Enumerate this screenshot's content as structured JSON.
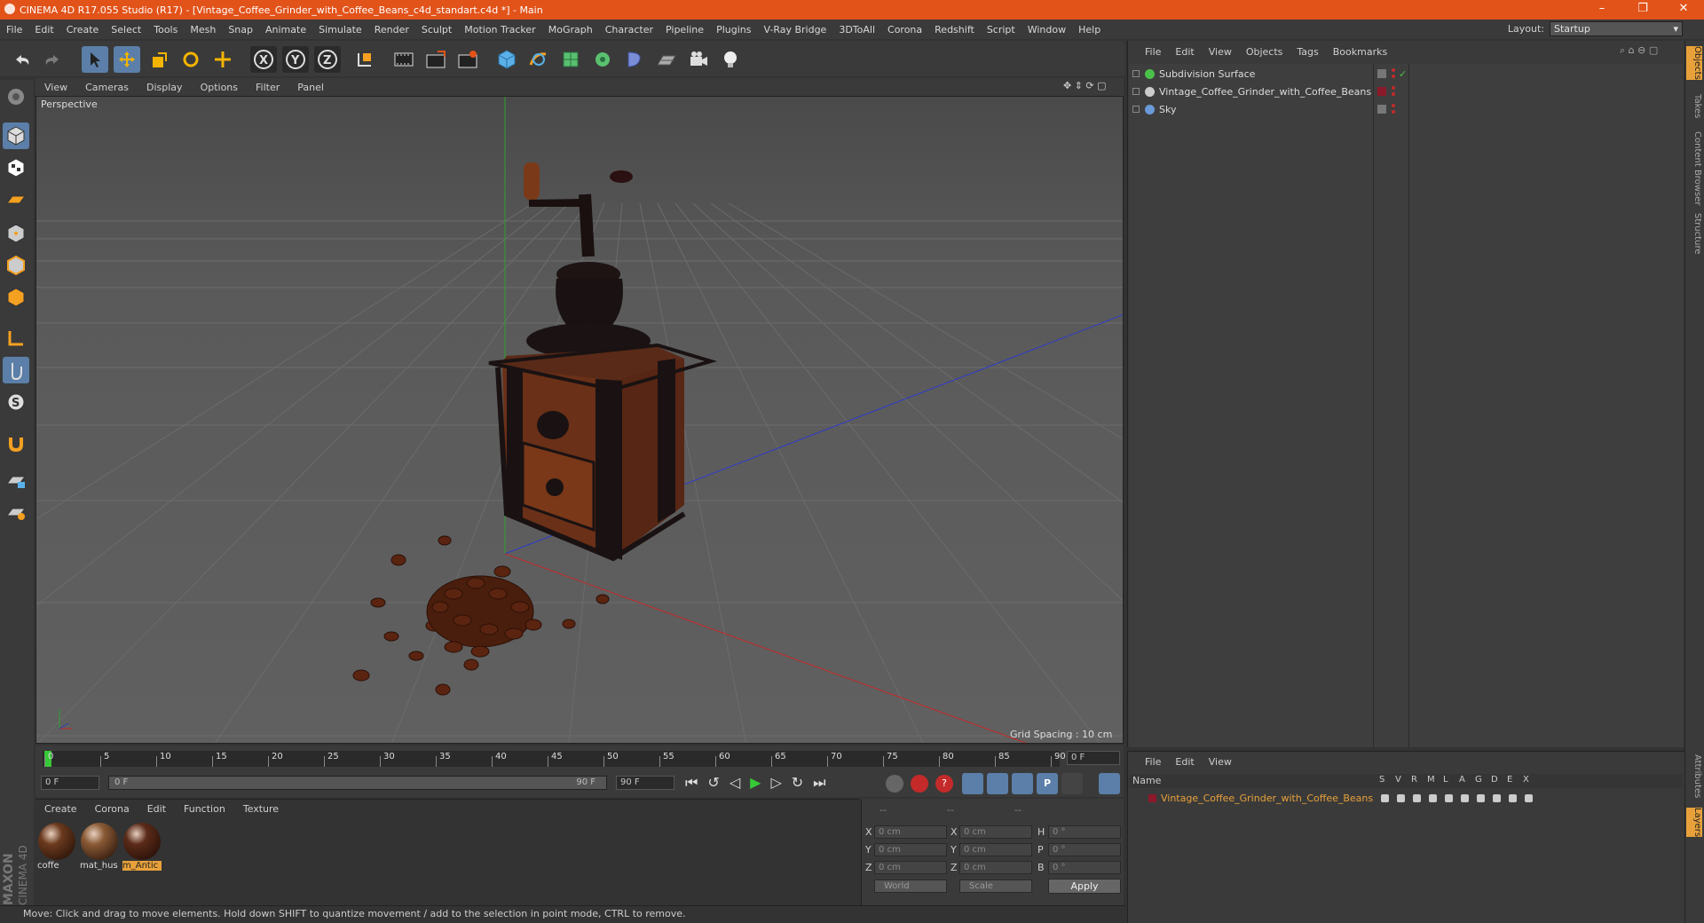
{
  "window": {
    "title": "CINEMA 4D R17.055 Studio (R17) - [Vintage_Coffee_Grinder_with_Coffee_Beans_c4d_standart.c4d *] - Main",
    "minimize": "–",
    "maximize": "❐",
    "close": "✕"
  },
  "menu": [
    "File",
    "Edit",
    "Create",
    "Select",
    "Tools",
    "Mesh",
    "Snap",
    "Animate",
    "Simulate",
    "Render",
    "Sculpt",
    "Motion Tracker",
    "MoGraph",
    "Character",
    "Pipeline",
    "Plugins",
    "V-Ray Bridge",
    "3DToAll",
    "Corona",
    "Redshift",
    "Script",
    "Window",
    "Help"
  ],
  "layout": {
    "label": "Layout:",
    "value": "Startup"
  },
  "viewport": {
    "menu": [
      "View",
      "Cameras",
      "Display",
      "Options",
      "Filter",
      "Panel"
    ],
    "label": "Perspective",
    "grid_spacing": "Grid Spacing : 10 cm"
  },
  "timeline": {
    "ticks": [
      "0",
      "5",
      "10",
      "15",
      "20",
      "25",
      "30",
      "35",
      "40",
      "45",
      "50",
      "55",
      "60",
      "65",
      "70",
      "75",
      "80",
      "85",
      "90"
    ],
    "current_frame": "0 F",
    "start_field": "0 F",
    "range_start": "0 F",
    "range_end": "90 F",
    "end_field": "90 F"
  },
  "materials": {
    "menu": [
      "Create",
      "Corona",
      "Edit",
      "Function",
      "Texture"
    ],
    "items": [
      {
        "label": "coffe",
        "color": "#6b3a1e"
      },
      {
        "label": "mat_hus",
        "color": "#8a5a35"
      },
      {
        "label": "m_Antic",
        "color": "#5a2a18"
      }
    ]
  },
  "coords": {
    "header": [
      "--",
      "--",
      "--"
    ],
    "rows": [
      {
        "a": "X",
        "av": "0 cm",
        "b": "X",
        "bv": "0 cm",
        "c": "H",
        "cv": "0 °"
      },
      {
        "a": "Y",
        "av": "0 cm",
        "b": "Y",
        "bv": "0 cm",
        "c": "P",
        "cv": "0 °"
      },
      {
        "a": "Z",
        "av": "0 cm",
        "b": "Z",
        "bv": "0 cm",
        "c": "B",
        "cv": "0 °"
      }
    ],
    "world": "World",
    "scale": "Scale",
    "apply": "Apply"
  },
  "status": "Move: Click and drag to move elements. Hold down SHIFT to quantize movement / add to the selection in point mode, CTRL to remove.",
  "objects": {
    "menu": [
      "File",
      "Edit",
      "View",
      "Objects",
      "Tags",
      "Bookmarks"
    ],
    "items": [
      {
        "name": "Subdivision Surface"
      },
      {
        "name": "Vintage_Coffee_Grinder_with_Coffee_Beans"
      },
      {
        "name": "Sky"
      }
    ]
  },
  "layers": {
    "menu": [
      "File",
      "Edit",
      "View"
    ],
    "header_name": "Name",
    "header_cols": [
      "S",
      "V",
      "R",
      "M",
      "L",
      "A",
      "G",
      "D",
      "E",
      "X"
    ],
    "items": [
      {
        "name": "Vintage_Coffee_Grinder_with_Coffee_Beans"
      }
    ]
  },
  "right_tabs": [
    "Objects",
    "Takes",
    "Content Browser",
    "Structure",
    "Attributes",
    "Layers"
  ],
  "maxon": "MAXON",
  "cinema": "CINEMA 4D",
  "colors": {
    "accent": "#e2531a",
    "highlight": "#5b7fa8",
    "layer_text": "#e8a13a"
  }
}
